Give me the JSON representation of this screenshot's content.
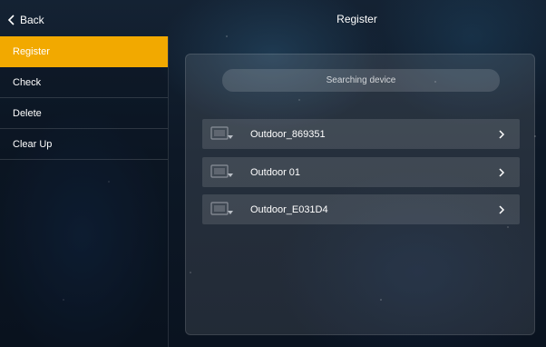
{
  "header": {
    "back_label": "Back",
    "title": "Register"
  },
  "sidebar": {
    "items": [
      {
        "label": "Register",
        "active": true
      },
      {
        "label": "Check",
        "active": false
      },
      {
        "label": "Delete",
        "active": false
      },
      {
        "label": "Clear Up",
        "active": false
      }
    ]
  },
  "main": {
    "search_status": "Searching device",
    "devices": [
      {
        "name": "Outdoor_869351",
        "icon": "outdoor-station-icon"
      },
      {
        "name": "Outdoor 01",
        "icon": "outdoor-station-icon"
      },
      {
        "name": "Outdoor_E031D4",
        "icon": "outdoor-station-icon"
      }
    ]
  },
  "colors": {
    "accent": "#f2a900",
    "background": "#0d1826"
  }
}
